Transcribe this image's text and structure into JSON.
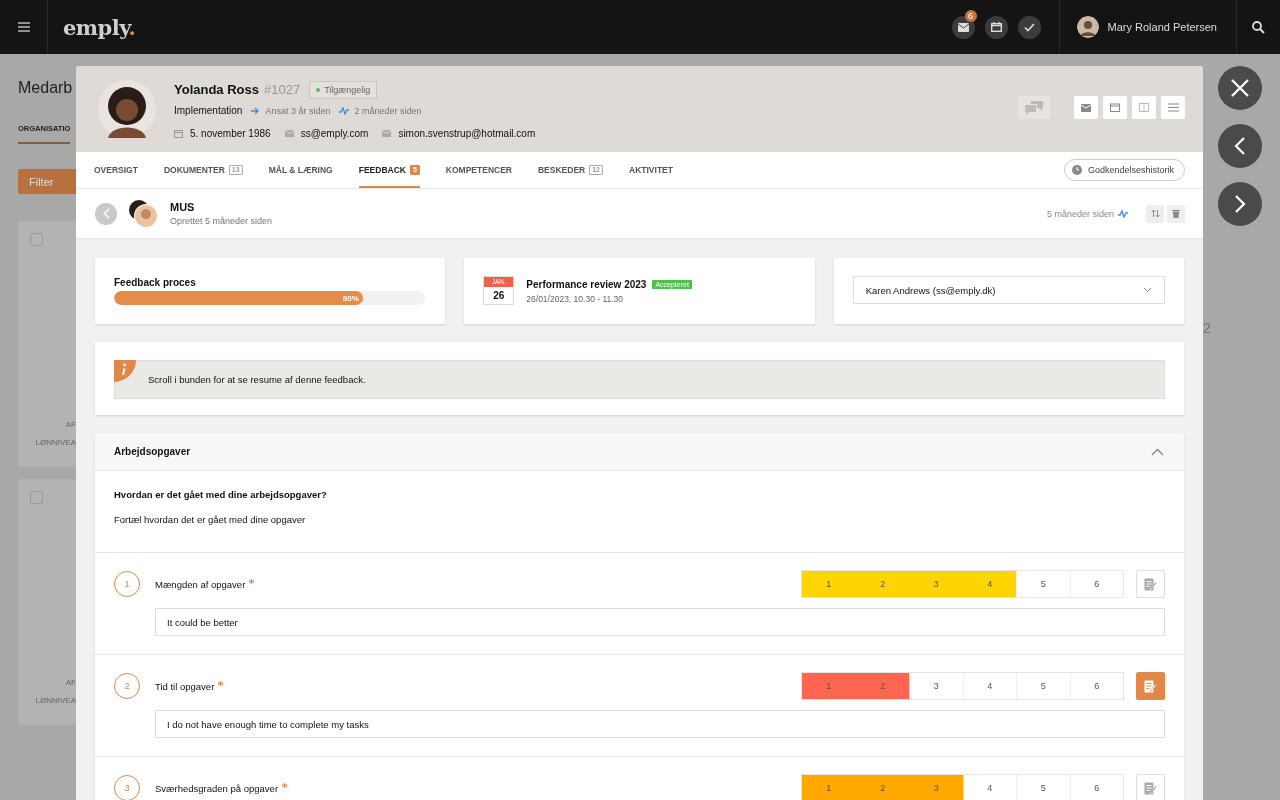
{
  "topbar": {
    "logo": "emply",
    "logo_mark": ".",
    "mail_badge": "6",
    "user_name": "Mary Roland Petersen"
  },
  "background": {
    "title": "Medarb",
    "tab": "ORGANISATIO",
    "filter": "Filter",
    "cards": [
      {
        "checked": false,
        "labels": [
          "AF",
          "LØNNIVEA"
        ]
      },
      {
        "checked": false,
        "labels": [
          "AF",
          "LØNNIVEA"
        ]
      }
    ],
    "side_number": "2"
  },
  "profile": {
    "name": "Yolanda Ross",
    "number": "#1027",
    "status": "Tilgængelig",
    "department": "Implementation",
    "employed": "Ansat 3 år siden",
    "activity": "2 måneder siden",
    "birthday": "5. november 1986",
    "email": "ss@emply.com",
    "email_private": "simon.svenstrup@hotmail.com"
  },
  "tabs": [
    {
      "label": "OVERSIGT",
      "selected": false
    },
    {
      "label": "DOKUMENTER",
      "count": "13",
      "selected": false
    },
    {
      "label": "MÅL & LÆRING",
      "selected": false
    },
    {
      "label": "FEEDBACK",
      "count": "5",
      "selected": true
    },
    {
      "label": "KOMPETENCER",
      "selected": false
    },
    {
      "label": "BESKEDER",
      "count": "12",
      "selected": false
    },
    {
      "label": "AKTIVITET",
      "selected": false
    }
  ],
  "history_button": "Godkendelseshistorik",
  "feedback": {
    "title": "MUS",
    "created": "Oprettet 5 måneder siden",
    "updated": "5 måneder siden"
  },
  "progress": {
    "label": "Feedback proces",
    "level": 0.8,
    "reading": "80%"
  },
  "meeting": {
    "month": "JAN.",
    "day": "26",
    "title": "Performance review 2023",
    "status": "Accepteret",
    "time": "26/01/2023, 10.30 - 11.30"
  },
  "reviewer": {
    "value": "Karen Andrews (ss@emply.dk)"
  },
  "info": "Scroll i bunden for at se resume af denne feedback.",
  "section": {
    "title": "Arbejdsopgaver",
    "expanded": true,
    "question": "Hvordan er det gået med dine arbejdsopgaver?",
    "description": "Fortæl hvordan det er gået med dine opgaver",
    "items": [
      {
        "number": "1",
        "label": "Mængden af opgaver",
        "required": true,
        "color": "#ffd500",
        "note_active": false,
        "comment": "It could be better",
        "scale": [
          {
            "label": "1",
            "selected": true
          },
          {
            "label": "2",
            "selected": true
          },
          {
            "label": "3",
            "selected": true
          },
          {
            "label": "4",
            "selected": true
          },
          {
            "label": "5",
            "selected": false
          },
          {
            "label": "6",
            "selected": false
          }
        ]
      },
      {
        "number": "2",
        "label": "Tid til opgaver",
        "required": true,
        "color": "#ff6650",
        "note_active": true,
        "comment": "I do not have enough time to complete my tasks",
        "scale": [
          {
            "label": "1",
            "selected": true
          },
          {
            "label": "2",
            "selected": true
          },
          {
            "label": "3",
            "selected": false
          },
          {
            "label": "4",
            "selected": false
          },
          {
            "label": "5",
            "selected": false
          },
          {
            "label": "6",
            "selected": false
          }
        ]
      },
      {
        "number": "3",
        "label": "Sværhedsgraden på opgaver",
        "required": true,
        "color": "#ffa800",
        "note_active": false,
        "scale": [
          {
            "label": "1",
            "selected": true
          },
          {
            "label": "2",
            "selected": true
          },
          {
            "label": "3",
            "selected": true
          },
          {
            "label": "4",
            "selected": false
          },
          {
            "label": "5",
            "selected": false
          },
          {
            "label": "6",
            "selected": false
          }
        ]
      }
    ]
  }
}
